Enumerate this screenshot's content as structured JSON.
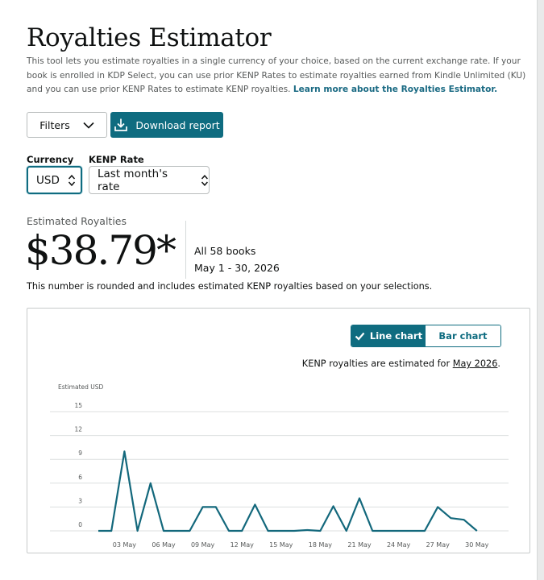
{
  "page": {
    "title": "Royalties Estimator",
    "intro_text": "This tool lets you estimate royalties in a single currency of your choice, based on the current exchange rate. If your book is enrolled in KDP Select, you can use prior KENP Rates to estimate royalties earned from Kindle Unlimited (KU) and you can use prior KENP Rates to estimate KENP royalties.",
    "learn_more_link": "Learn more about the Royalties Estimator."
  },
  "toolbar": {
    "filters_label": "Filters",
    "download_label": "Download report"
  },
  "selectors": {
    "currency_label": "Currency",
    "currency_value": "USD",
    "kenp_label": "KENP Rate",
    "kenp_value": "Last month's rate"
  },
  "estimate": {
    "label": "Estimated Royalties",
    "value": "$38.79*",
    "books": "All 58 books",
    "date_range": "May 1 - 30, 2026",
    "note": "This number is rounded and includes estimated KENP royalties based on your selections."
  },
  "chart_toggle": {
    "line_label": "Line chart",
    "bar_label": "Bar chart",
    "selected": "line"
  },
  "kenp_note": {
    "prefix": "KENP royalties are estimated for ",
    "month": "May 2026",
    "suffix": "."
  },
  "colors": {
    "accent": "#0f6c80",
    "line": "#13687c",
    "grid": "#dcdfdf"
  },
  "chart_data": {
    "type": "line",
    "ylabel": "Estimated USD",
    "ylim": [
      0,
      15
    ],
    "yticks": [
      0,
      3,
      6,
      9,
      12,
      15
    ],
    "grid": true,
    "x": [
      "01 May",
      "02 May",
      "03 May",
      "04 May",
      "05 May",
      "06 May",
      "07 May",
      "08 May",
      "09 May",
      "10 May",
      "11 May",
      "12 May",
      "13 May",
      "14 May",
      "15 May",
      "16 May",
      "17 May",
      "18 May",
      "19 May",
      "20 May",
      "21 May",
      "22 May",
      "23 May",
      "24 May",
      "25 May",
      "26 May",
      "27 May",
      "28 May",
      "29 May",
      "30 May"
    ],
    "x_tick_labels": [
      "03 May",
      "06 May",
      "09 May",
      "12 May",
      "15 May",
      "18 May",
      "21 May",
      "24 May",
      "27 May",
      "30 May"
    ],
    "series": [
      {
        "values": [
          0,
          0,
          10,
          0,
          6,
          0,
          0,
          0,
          3,
          3,
          0,
          0,
          3.3,
          0,
          0,
          0,
          0.1,
          0,
          3.1,
          0,
          4.1,
          0,
          0,
          0,
          0,
          0,
          3,
          1.6,
          1.4,
          0
        ]
      }
    ]
  }
}
